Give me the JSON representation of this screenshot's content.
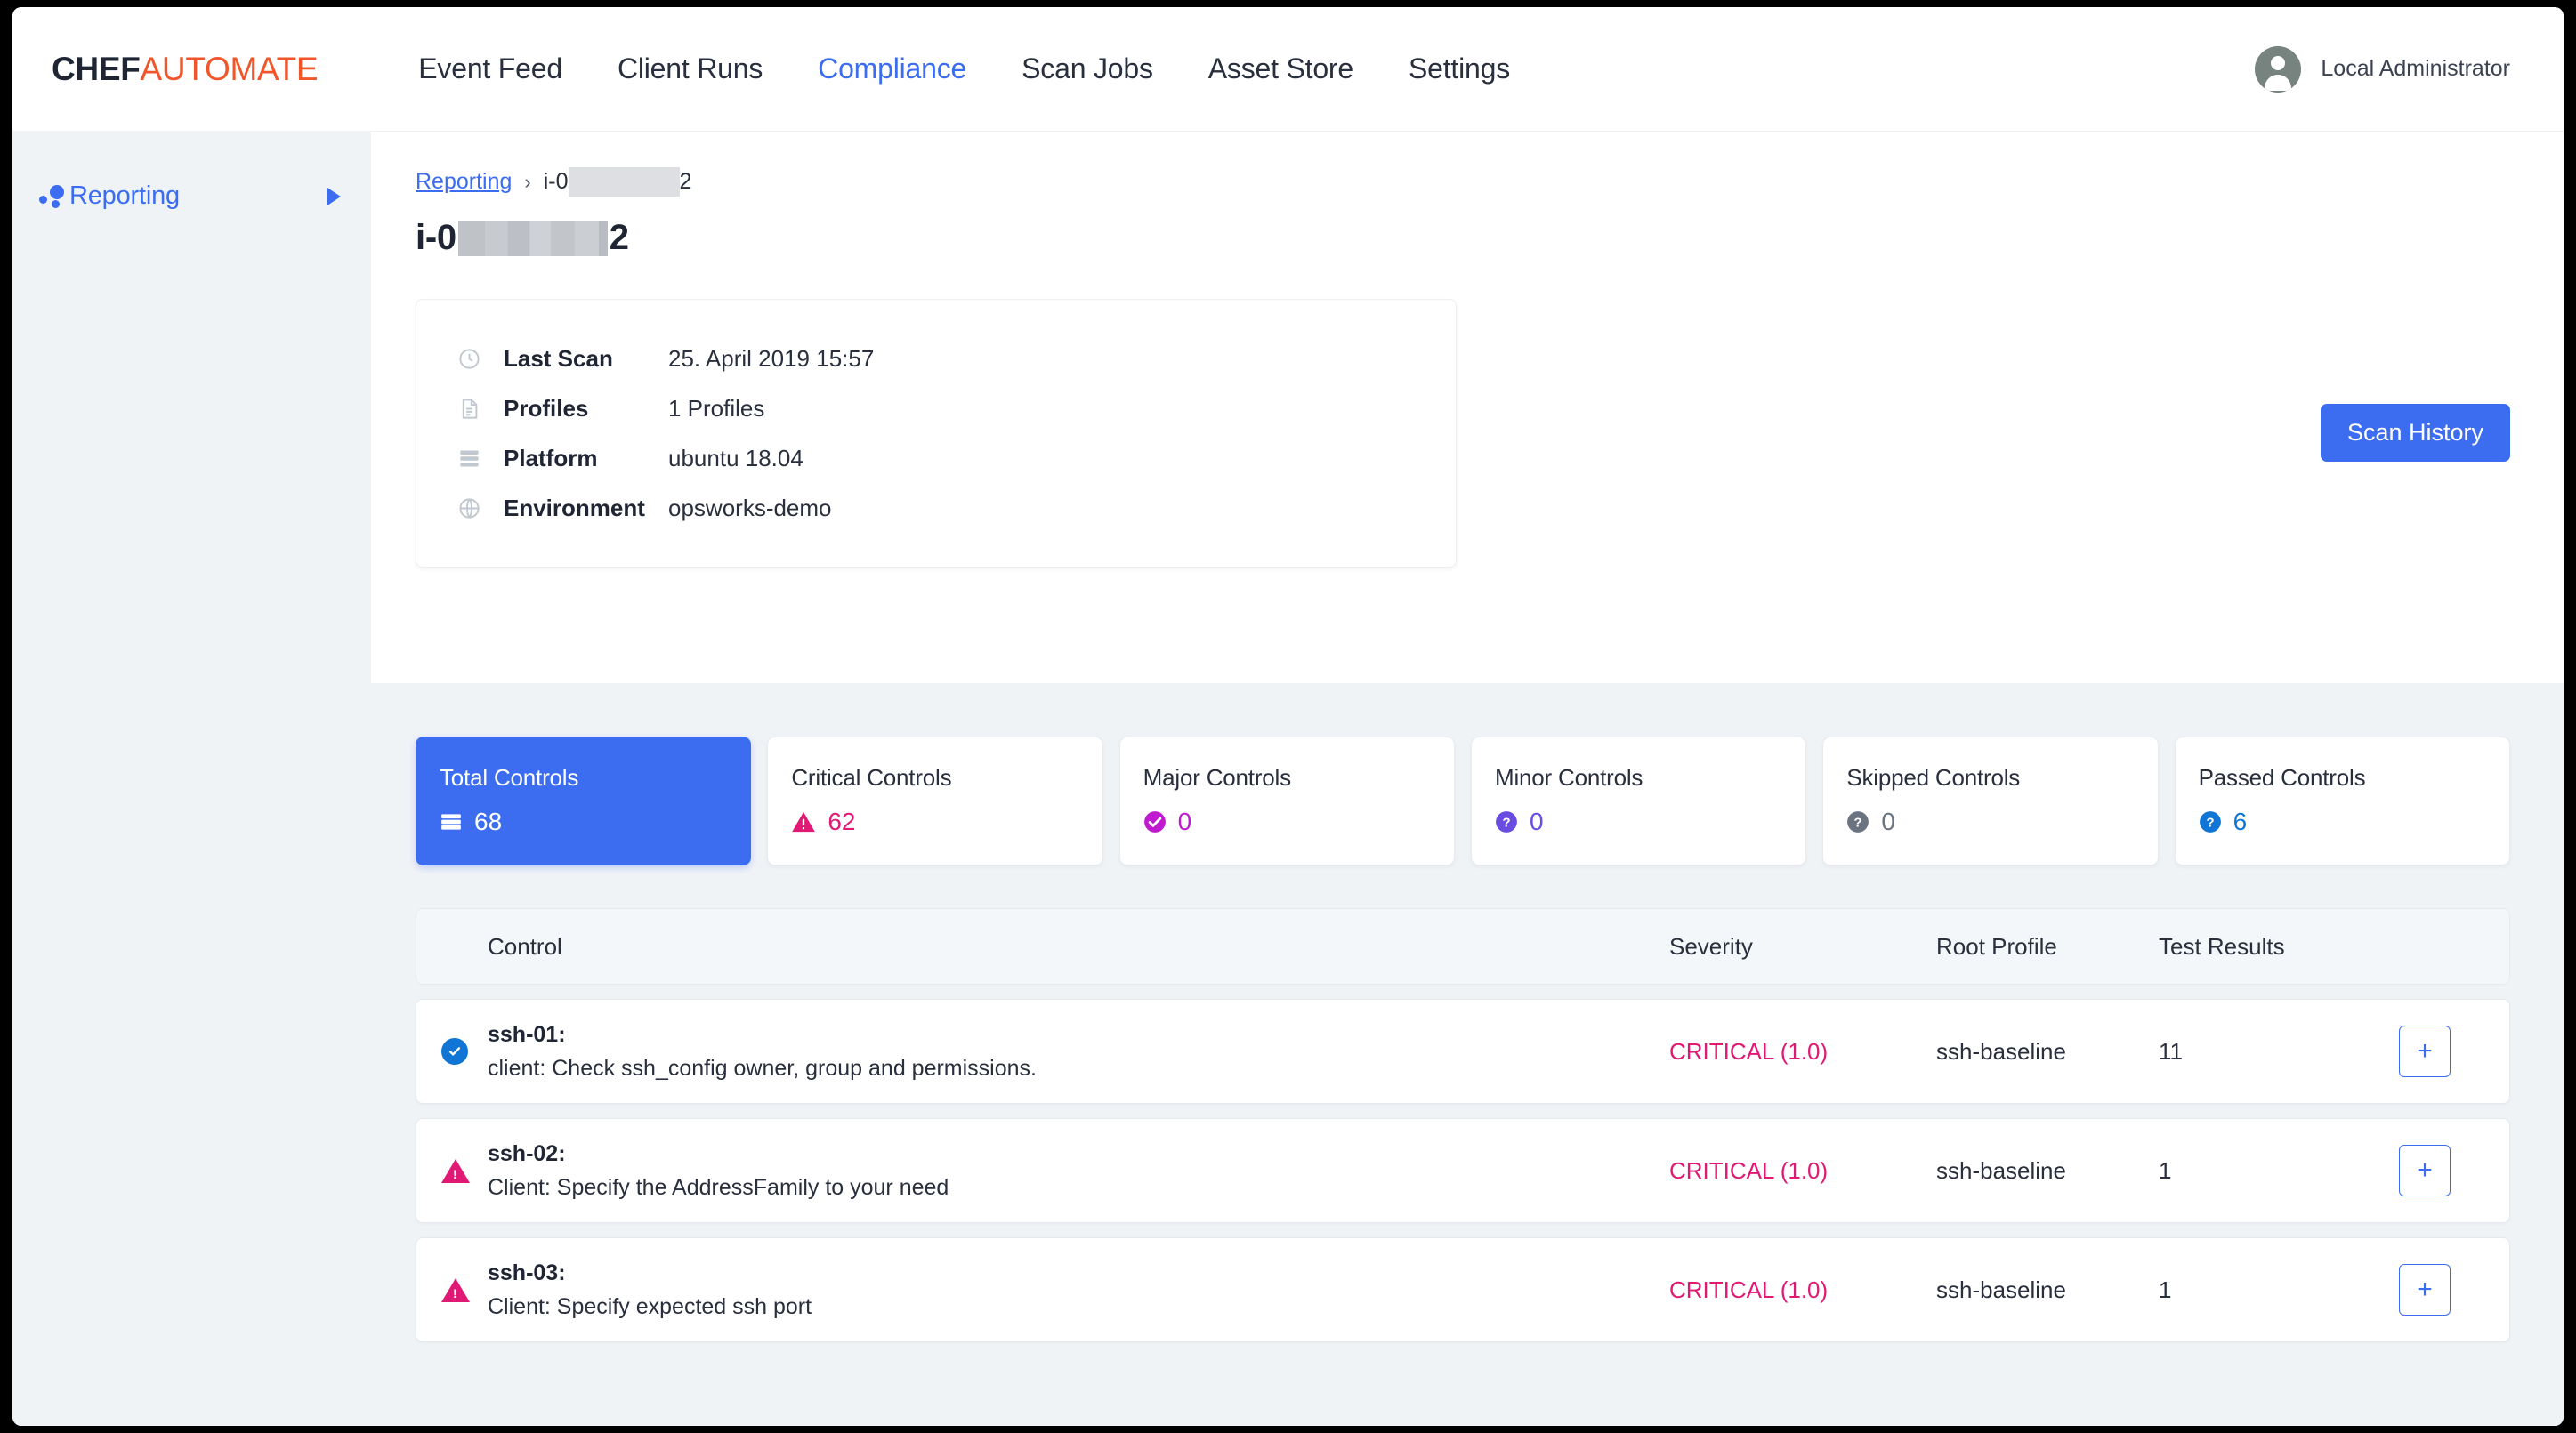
{
  "brand": {
    "part1": "CHEF",
    "part2": "AUTOMATE"
  },
  "nav": {
    "items": [
      {
        "label": "Event Feed",
        "active": false
      },
      {
        "label": "Client Runs",
        "active": false
      },
      {
        "label": "Compliance",
        "active": true
      },
      {
        "label": "Scan Jobs",
        "active": false
      },
      {
        "label": "Asset Store",
        "active": false
      },
      {
        "label": "Settings",
        "active": false
      }
    ],
    "user": "Local Administrator",
    "user_icon": "person-avatar-icon"
  },
  "sidebar": {
    "items": [
      {
        "label": "Reporting",
        "icon": "dots-cluster-icon",
        "caret": "caret-right-icon",
        "active": true
      }
    ]
  },
  "breadcrumb": {
    "root": "Reporting",
    "separator": "›",
    "node_prefix": "i-0",
    "node_suffix": "2",
    "redacted": true
  },
  "page": {
    "title_prefix": "i-0",
    "title_suffix": "2",
    "scan_history_label": "Scan History"
  },
  "info_card": {
    "rows": [
      {
        "icon": "clock-icon",
        "label": "Last Scan",
        "value": "25. April 2019 15:57"
      },
      {
        "icon": "document-icon",
        "label": "Profiles",
        "value": "1 Profiles"
      },
      {
        "icon": "server-list-icon",
        "label": "Platform",
        "value": "ubuntu 18.04"
      },
      {
        "icon": "globe-icon",
        "label": "Environment",
        "value": "opsworks-demo"
      }
    ]
  },
  "stats": [
    {
      "title": "Total Controls",
      "value": "68",
      "icon": "server-list-icon",
      "icon_color": "#ffffff",
      "value_color": "#ffffff",
      "active": true
    },
    {
      "title": "Critical Controls",
      "value": "62",
      "icon": "warning-triangle-icon",
      "icon_color": "#e01a74",
      "value_color": "#e01a74",
      "active": false
    },
    {
      "title": "Major Controls",
      "value": "0",
      "icon": "check-circle-icon",
      "icon_color": "#c01ad0",
      "value_color": "#c01ad0",
      "active": false
    },
    {
      "title": "Minor Controls",
      "value": "0",
      "icon": "question-circle-icon",
      "icon_color": "#6a4ce0",
      "value_color": "#6a4ce0",
      "active": false
    },
    {
      "title": "Skipped Controls",
      "value": "0",
      "icon": "question-circle-icon",
      "icon_color": "#6b7280",
      "value_color": "#6b7280",
      "active": false
    },
    {
      "title": "Passed Controls",
      "value": "6",
      "icon": "question-circle-icon",
      "icon_color": "#1075d4",
      "value_color": "#1075d4",
      "active": false
    }
  ],
  "table": {
    "headers": {
      "control": "Control",
      "severity": "Severity",
      "root_profile": "Root Profile",
      "test_results": "Test Results"
    },
    "expand_label": "+",
    "rows": [
      {
        "status_icon": "check-circle-icon",
        "status": "passed",
        "name": "ssh-01:",
        "description": "client: Check ssh_config owner, group and permissions.",
        "severity": "CRITICAL (1.0)",
        "root_profile": "ssh-baseline",
        "test_results": "11"
      },
      {
        "status_icon": "warning-triangle-icon",
        "status": "failed",
        "name": "ssh-02:",
        "description": "Client: Specify the AddressFamily to your need",
        "severity": "CRITICAL (1.0)",
        "root_profile": "ssh-baseline",
        "test_results": "1"
      },
      {
        "status_icon": "warning-triangle-icon",
        "status": "failed",
        "name": "ssh-03:",
        "description": "Client: Specify expected ssh port",
        "severity": "CRITICAL (1.0)",
        "root_profile": "ssh-baseline",
        "test_results": "1"
      }
    ]
  },
  "colors": {
    "brand_orange": "#f1562b",
    "accent_blue": "#3c6df0",
    "critical_pink": "#e01a74",
    "page_bg": "#f0f3f6"
  }
}
